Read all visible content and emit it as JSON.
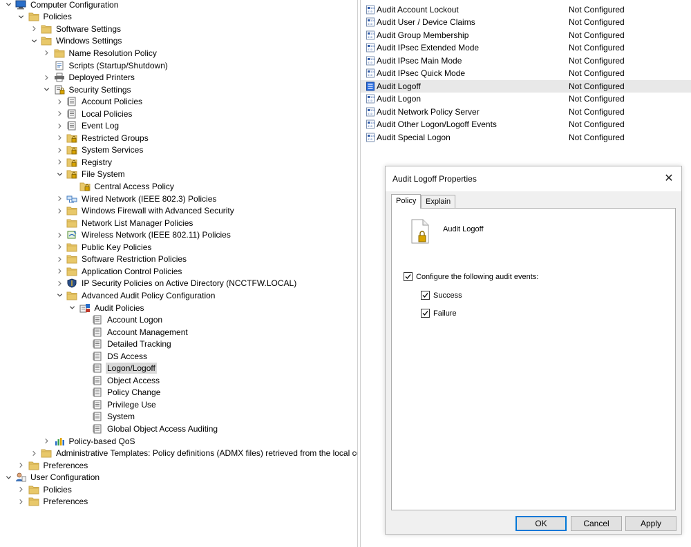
{
  "tree": {
    "items": [
      {
        "label": "Computer Configuration",
        "level": 0,
        "expander": "expanded",
        "icon": "computer-icon",
        "name": "computer-configuration"
      },
      {
        "label": "Policies",
        "level": 1,
        "expander": "expanded",
        "icon": "folder-icon",
        "name": "policies"
      },
      {
        "label": "Software Settings",
        "level": 2,
        "expander": "collapsed",
        "icon": "folder-icon",
        "name": "software-settings"
      },
      {
        "label": "Windows Settings",
        "level": 2,
        "expander": "expanded",
        "icon": "folder-icon",
        "name": "windows-settings"
      },
      {
        "label": "Name Resolution Policy",
        "level": 3,
        "expander": "collapsed",
        "icon": "folder-icon",
        "name": "name-resolution-policy"
      },
      {
        "label": "Scripts (Startup/Shutdown)",
        "level": 3,
        "expander": "none",
        "icon": "script-icon",
        "name": "scripts-startup-shutdown"
      },
      {
        "label": "Deployed Printers",
        "level": 3,
        "expander": "collapsed",
        "icon": "printer-icon",
        "name": "deployed-printers"
      },
      {
        "label": "Security Settings",
        "level": 3,
        "expander": "expanded",
        "icon": "security-settings-icon",
        "name": "security-settings"
      },
      {
        "label": "Account Policies",
        "level": 4,
        "expander": "collapsed",
        "icon": "policy-book-icon",
        "name": "account-policies"
      },
      {
        "label": "Local Policies",
        "level": 4,
        "expander": "collapsed",
        "icon": "policy-book-icon",
        "name": "local-policies"
      },
      {
        "label": "Event Log",
        "level": 4,
        "expander": "collapsed",
        "icon": "policy-book-icon",
        "name": "event-log"
      },
      {
        "label": "Restricted Groups",
        "level": 4,
        "expander": "collapsed",
        "icon": "locked-folder-icon",
        "name": "restricted-groups"
      },
      {
        "label": "System Services",
        "level": 4,
        "expander": "collapsed",
        "icon": "locked-folder-icon",
        "name": "system-services"
      },
      {
        "label": "Registry",
        "level": 4,
        "expander": "collapsed",
        "icon": "locked-folder-icon",
        "name": "registry"
      },
      {
        "label": "File System",
        "level": 4,
        "expander": "expanded",
        "icon": "locked-folder-icon",
        "name": "file-system"
      },
      {
        "label": "Central Access Policy",
        "level": 5,
        "expander": "none",
        "icon": "locked-folder-icon",
        "name": "central-access-policy"
      },
      {
        "label": "Wired Network (IEEE 802.3) Policies",
        "level": 4,
        "expander": "collapsed",
        "icon": "network-icon",
        "name": "wired-network-policies"
      },
      {
        "label": "Windows Firewall with Advanced Security",
        "level": 4,
        "expander": "collapsed",
        "icon": "folder-icon",
        "name": "windows-firewall"
      },
      {
        "label": "Network List Manager Policies",
        "level": 4,
        "expander": "none",
        "icon": "folder-icon",
        "name": "network-list-manager-policies"
      },
      {
        "label": "Wireless Network (IEEE 802.11) Policies",
        "level": 4,
        "expander": "collapsed",
        "icon": "wireless-icon",
        "name": "wireless-network-policies"
      },
      {
        "label": "Public Key Policies",
        "level": 4,
        "expander": "collapsed",
        "icon": "folder-icon",
        "name": "public-key-policies"
      },
      {
        "label": "Software Restriction Policies",
        "level": 4,
        "expander": "collapsed",
        "icon": "folder-icon",
        "name": "software-restriction-policies"
      },
      {
        "label": "Application Control Policies",
        "level": 4,
        "expander": "collapsed",
        "icon": "folder-icon",
        "name": "application-control-policies"
      },
      {
        "label": "IP Security Policies on Active Directory (NCCTFW.LOCAL)",
        "level": 4,
        "expander": "collapsed",
        "icon": "ip-security-icon",
        "name": "ip-security-policies"
      },
      {
        "label": "Advanced Audit Policy Configuration",
        "level": 4,
        "expander": "expanded",
        "icon": "folder-icon",
        "name": "advanced-audit-policy-configuration"
      },
      {
        "label": "Audit Policies",
        "level": 5,
        "expander": "expanded",
        "icon": "audit-policies-icon",
        "name": "audit-policies"
      },
      {
        "label": "Account Logon",
        "level": 6,
        "expander": "none",
        "icon": "policy-book-icon",
        "name": "account-logon"
      },
      {
        "label": "Account Management",
        "level": 6,
        "expander": "none",
        "icon": "policy-book-icon",
        "name": "account-management"
      },
      {
        "label": "Detailed Tracking",
        "level": 6,
        "expander": "none",
        "icon": "policy-book-icon",
        "name": "detailed-tracking"
      },
      {
        "label": "DS Access",
        "level": 6,
        "expander": "none",
        "icon": "policy-book-icon",
        "name": "ds-access"
      },
      {
        "label": "Logon/Logoff",
        "level": 6,
        "expander": "none",
        "icon": "policy-book-icon",
        "name": "logon-logoff",
        "selected": true
      },
      {
        "label": "Object Access",
        "level": 6,
        "expander": "none",
        "icon": "policy-book-icon",
        "name": "object-access"
      },
      {
        "label": "Policy Change",
        "level": 6,
        "expander": "none",
        "icon": "policy-book-icon",
        "name": "policy-change"
      },
      {
        "label": "Privilege Use",
        "level": 6,
        "expander": "none",
        "icon": "policy-book-icon",
        "name": "privilege-use"
      },
      {
        "label": "System",
        "level": 6,
        "expander": "none",
        "icon": "policy-book-icon",
        "name": "system"
      },
      {
        "label": "Global Object Access Auditing",
        "level": 6,
        "expander": "none",
        "icon": "policy-book-icon",
        "name": "global-object-access-auditing"
      },
      {
        "label": "Policy-based QoS",
        "level": 3,
        "expander": "collapsed",
        "icon": "qos-chart-icon",
        "name": "policy-based-qos"
      },
      {
        "label": "Administrative Templates: Policy definitions (ADMX files) retrieved from the local computer",
        "level": 2,
        "expander": "collapsed",
        "icon": "folder-icon",
        "name": "administrative-templates"
      },
      {
        "label": "Preferences",
        "level": 1,
        "expander": "collapsed",
        "icon": "folder-icon",
        "name": "preferences-computer"
      },
      {
        "label": "User Configuration",
        "level": 0,
        "expander": "expanded",
        "icon": "user-config-icon",
        "name": "user-configuration"
      },
      {
        "label": "Policies",
        "level": 1,
        "expander": "collapsed",
        "icon": "folder-icon",
        "name": "policies-user"
      },
      {
        "label": "Preferences",
        "level": 1,
        "expander": "collapsed",
        "icon": "folder-icon",
        "name": "preferences-user"
      }
    ]
  },
  "list": {
    "rows": [
      {
        "name": "Audit Account Lockout",
        "value": "Not Configured"
      },
      {
        "name": "Audit User / Device Claims",
        "value": "Not Configured"
      },
      {
        "name": "Audit Group Membership",
        "value": "Not Configured"
      },
      {
        "name": "Audit IPsec Extended Mode",
        "value": "Not Configured"
      },
      {
        "name": "Audit IPsec Main Mode",
        "value": "Not Configured"
      },
      {
        "name": "Audit IPsec Quick Mode",
        "value": "Not Configured"
      },
      {
        "name": "Audit Logoff",
        "value": "Not Configured",
        "selected": true
      },
      {
        "name": "Audit Logon",
        "value": "Not Configured"
      },
      {
        "name": "Audit Network Policy Server",
        "value": "Not Configured"
      },
      {
        "name": "Audit Other Logon/Logoff Events",
        "value": "Not Configured"
      },
      {
        "name": "Audit Special Logon",
        "value": "Not Configured"
      }
    ]
  },
  "dialog": {
    "title": "Audit Logoff Properties",
    "close_glyph": "✕",
    "tabs": [
      {
        "label": "Policy",
        "active": true
      },
      {
        "label": "Explain",
        "active": false
      }
    ],
    "policy_name": "Audit Logoff",
    "configure_label": "Configure the following audit events:",
    "configure_checked": true,
    "success_label": "Success",
    "success_checked": true,
    "failure_label": "Failure",
    "failure_checked": true,
    "ok_label": "OK",
    "cancel_label": "Cancel",
    "apply_label": "Apply"
  },
  "colors": {
    "folder": "#e8c86a",
    "folder_dark": "#c9a548",
    "selection_tree": "#d9d9d9",
    "selection_list": "#e8e8e8",
    "default_button_border": "#0078d7"
  }
}
